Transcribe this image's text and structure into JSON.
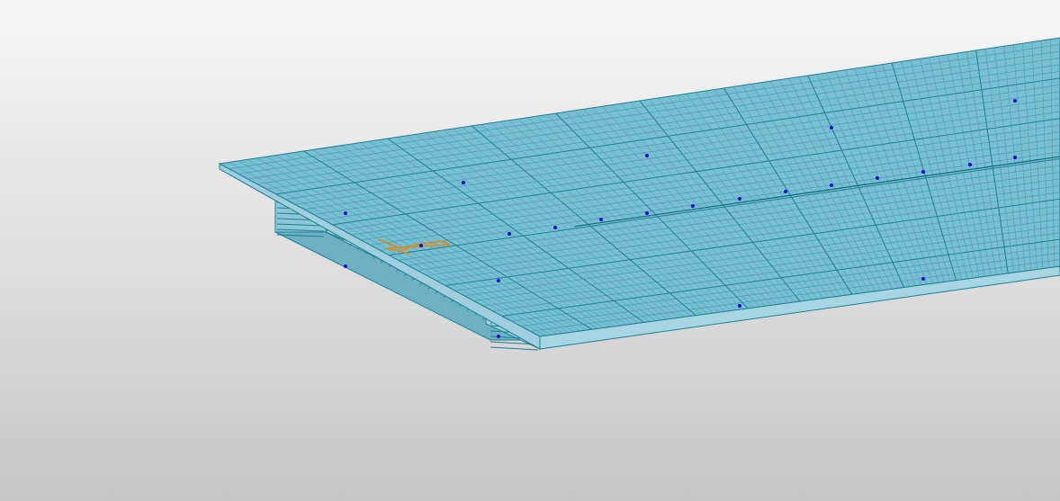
{
  "viewport": {
    "background_top": "#f6f6f6",
    "background_bottom": "#c6c6c6"
  },
  "model": {
    "object": "bridge-deck-mesh",
    "mesh_fill": "#79bfd1",
    "mesh_line": "#1b7f93",
    "mesh_line_fine": "#3b9bb0",
    "side_fill": "#9fcfde",
    "interior_fill": "#6fb0c3",
    "node_color": "#1010cc",
    "highlight_color": "#e08a10"
  }
}
